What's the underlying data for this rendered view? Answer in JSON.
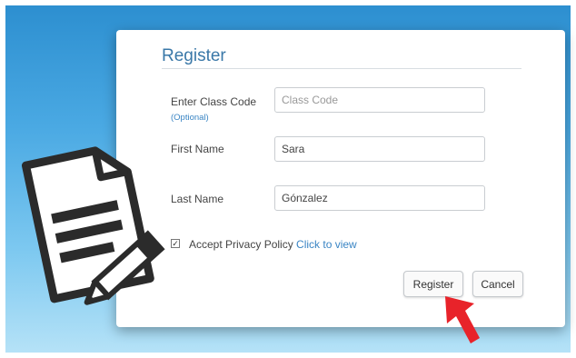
{
  "form": {
    "title": "Register",
    "class_code": {
      "label": "Enter Class Code",
      "optional": "(Optional)",
      "value": "",
      "placeholder": "Class Code"
    },
    "first_name": {
      "label": "First Name",
      "value": "Sara"
    },
    "last_name": {
      "label": "Last Name",
      "value": "Gónzalez"
    },
    "privacy": {
      "checked": true,
      "text": "Accept Privacy Policy",
      "link": "Click to view"
    },
    "buttons": {
      "register": "Register",
      "cancel": "Cancel"
    }
  },
  "colors": {
    "accent": "#3a78a8",
    "link": "#3a85c4",
    "arrow": "#e8232a"
  },
  "icons": [
    "document-pencil-icon",
    "red-arrow-icon"
  ]
}
